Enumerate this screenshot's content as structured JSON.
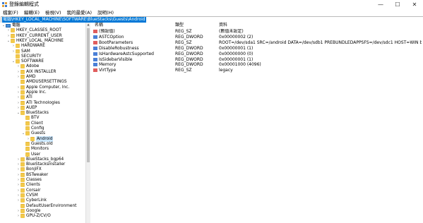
{
  "window": {
    "title": "登錄編輯程式",
    "minimize": "—",
    "maximize": "☐",
    "close": "✕"
  },
  "menu": [
    "檔案(F)",
    "編輯(E)",
    "檢視(V)",
    "我的最愛(A)",
    "說明(H)"
  ],
  "address": "電腦\\HKEY_LOCAL_MACHINE\\SOFTWARE\\BlueStacks\\Guests\\Android",
  "tree": [
    {
      "label": "電腦",
      "level": 0,
      "exp": "⌄",
      "icon": "pc"
    },
    {
      "label": "HKEY_CLASSES_ROOT",
      "level": 1,
      "exp": "›"
    },
    {
      "label": "HKEY_CURRENT_USER",
      "level": 1,
      "exp": "›"
    },
    {
      "label": "HKEY_LOCAL_MACHINE",
      "level": 1,
      "exp": "⌄"
    },
    {
      "label": "HARDWARE",
      "level": 2,
      "exp": "›"
    },
    {
      "label": "SAM",
      "level": 2,
      "exp": "›"
    },
    {
      "label": "SECURITY",
      "level": 2,
      "exp": ""
    },
    {
      "label": "SOFTWARE",
      "level": 2,
      "exp": "⌄"
    },
    {
      "label": "Adobe",
      "level": 3,
      "exp": "›"
    },
    {
      "label": "AIX INSTALLER",
      "level": 3,
      "exp": "›"
    },
    {
      "label": "AMD",
      "level": 3,
      "exp": "›"
    },
    {
      "label": "AMDUSERSETTINGS",
      "level": 3,
      "exp": ""
    },
    {
      "label": "Apple Computer, Inc.",
      "level": 3,
      "exp": "›"
    },
    {
      "label": "Apple Inc.",
      "level": 3,
      "exp": "›"
    },
    {
      "label": "ATI",
      "level": 3,
      "exp": "›"
    },
    {
      "label": "ATI Technologies",
      "level": 3,
      "exp": "›"
    },
    {
      "label": "AUEP",
      "level": 3,
      "exp": "›"
    },
    {
      "label": "BlueStacks",
      "level": 3,
      "exp": "⌄"
    },
    {
      "label": "BTV",
      "level": 4,
      "exp": ""
    },
    {
      "label": "Client",
      "level": 4,
      "exp": ""
    },
    {
      "label": "Config",
      "level": 4,
      "exp": ""
    },
    {
      "label": "Guests",
      "level": 4,
      "exp": "⌄"
    },
    {
      "label": "Android",
      "level": 5,
      "exp": "›",
      "selected": true
    },
    {
      "label": "Guests.old",
      "level": 4,
      "exp": ""
    },
    {
      "label": "Monitors",
      "level": 4,
      "exp": ""
    },
    {
      "label": "User",
      "level": 4,
      "exp": ""
    },
    {
      "label": "BlueStacks_bgp64",
      "level": 3,
      "exp": "›"
    },
    {
      "label": "BlueStacksInstaller",
      "level": 3,
      "exp": "›"
    },
    {
      "label": "BonjiFX",
      "level": 3,
      "exp": "›"
    },
    {
      "label": "BSTweaker",
      "level": 3,
      "exp": "›"
    },
    {
      "label": "Classes",
      "level": 3,
      "exp": "›"
    },
    {
      "label": "Clients",
      "level": 3,
      "exp": "›"
    },
    {
      "label": "Corsair",
      "level": 3,
      "exp": "›"
    },
    {
      "label": "CVSM",
      "level": 3,
      "exp": "›"
    },
    {
      "label": "CyberLink",
      "level": 3,
      "exp": "›"
    },
    {
      "label": "DefaultUserEnvironment",
      "level": 3,
      "exp": ""
    },
    {
      "label": "Google",
      "level": 3,
      "exp": "›"
    },
    {
      "label": "GPU-Z/CV/O",
      "level": 3,
      "exp": "›"
    }
  ],
  "list_headers": {
    "name": "名稱",
    "type": "類型",
    "data": "資料"
  },
  "values": [
    {
      "name": "(預設值)",
      "type": "REG_SZ",
      "data": "(數值未設定)",
      "kind": "sz"
    },
    {
      "name": "ASTCOption",
      "type": "REG_DWORD",
      "data": "0x00000002 (2)",
      "kind": "dw"
    },
    {
      "name": "BootParameters",
      "type": "REG_SZ",
      "data": "ROOT=/dev/sda1 SRC=/android DATA=/dev/sdb1 PREBUNDLEDAPPSFS=/dev/sdc1 HOST=WIN bsta...",
      "kind": "sz"
    },
    {
      "name": "DisableRobustness",
      "type": "REG_DWORD",
      "data": "0x00000001 (1)",
      "kind": "dw"
    },
    {
      "name": "IsHardwareAstcSupported",
      "type": "REG_DWORD",
      "data": "0x00000000 (0)",
      "kind": "dw"
    },
    {
      "name": "IsSidebarVisible",
      "type": "REG_DWORD",
      "data": "0x00000001 (1)",
      "kind": "dw"
    },
    {
      "name": "Memory",
      "type": "REG_DWORD",
      "data": "0x00001000 (4096)",
      "kind": "dw"
    },
    {
      "name": "VirtType",
      "type": "REG_SZ",
      "data": "legacy",
      "kind": "sz"
    }
  ]
}
